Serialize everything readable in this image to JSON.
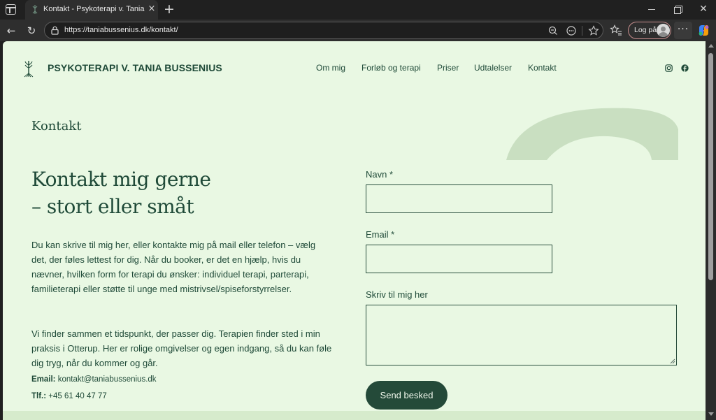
{
  "browser": {
    "tab_title": "Kontakt - Psykoterapi v. Tania Bussenius",
    "url": "https://taniabussenius.dk/kontakt/",
    "login_label": "Log på",
    "tab_close_glyph": "×",
    "new_tab_glyph": "+",
    "back_glyph": "←",
    "reload_glyph": "↻",
    "more_glyph": "···",
    "window_close_glyph": "✕",
    "icons": [
      "sidebar-toggle-icon",
      "favicon",
      "lock-icon",
      "zoom-out-icon",
      "page-actions-icon",
      "star-icon",
      "favorites-icon",
      "profile-avatar-icon",
      "copilot-icon"
    ]
  },
  "site": {
    "title": "PSYKOTERAPI V. TANIA BUSSENIUS",
    "nav": [
      "Om mig",
      "Forløb og terapi",
      "Priser",
      "Udtalelser",
      "Kontakt"
    ],
    "social_icons": [
      "instagram-icon",
      "facebook-icon"
    ]
  },
  "page": {
    "heading": "Kontakt",
    "headline_lines": [
      "Kontakt mig gerne",
      "– stort eller småt"
    ],
    "intro_lines": [
      "Du kan skrive til mig her, eller kontakte mig på mail eller telefon – vælg",
      "det, der føles lettest for dig. Når du booker, er det en hjælp, hvis du",
      "nævner, hvilken form for terapi du ønsker: individuel terapi, parterapi,",
      "familieterapi eller støtte til unge med mistrivsel/spiseforstyrrelser."
    ],
    "p2_lines": [
      "Vi finder sammen et tidspunkt, der passer dig. Terapien finder sted i min",
      "praksis i Otterup. Her er rolige omgivelser og egen indgang, så du kan føle",
      "dig tryg, når du kommer og går."
    ],
    "contact": {
      "email_label": "Email:",
      "email": "kontakt@taniabussenius.dk",
      "phone_label": "Tlf.:",
      "phone": "+45 61 40 47 77"
    }
  },
  "form": {
    "name_label": "Navn *",
    "email_label": "Email *",
    "message_label": "Skriv til mig her",
    "name_value": "",
    "email_value": "",
    "message_value": "",
    "submit_label": "Send besked"
  },
  "colors": {
    "page_bg": "#e9f8e3",
    "brand_green": "#1f4a38",
    "button_green": "#244a39",
    "deco_arc": "#c9dfc1"
  }
}
